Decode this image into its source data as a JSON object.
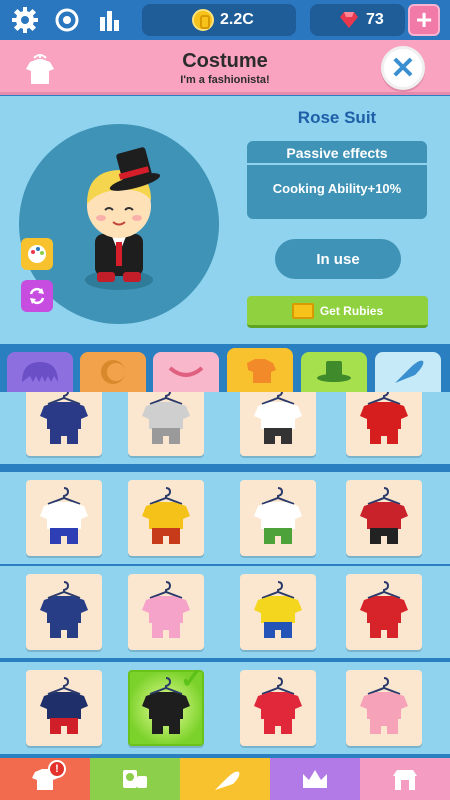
{
  "topbar": {
    "coins": "2.2C",
    "rubies": "73",
    "add_label": "+"
  },
  "header": {
    "title": "Costume",
    "subtitle": "I'm a fashionista!",
    "close_label": "✕"
  },
  "details": {
    "item_name": "Rose Suit",
    "effects_title": "Passive effects",
    "effect_value": "Cooking Ability+10%",
    "in_use_label": "In use",
    "get_rubies_label": "Get Rubies"
  },
  "tabs": [
    {
      "name": "hair",
      "color": "#8d6fe0"
    },
    {
      "name": "face",
      "color": "#f2a24a"
    },
    {
      "name": "mouth",
      "color": "#f9b7cc"
    },
    {
      "name": "clothes",
      "color": "#f8c22e"
    },
    {
      "name": "hat",
      "color": "#a6e04d"
    },
    {
      "name": "accessory",
      "color": "#c6eaf7"
    }
  ],
  "selected_tab": "clothes",
  "costume_rows": [
    [
      {
        "name": "navy-tracksuit",
        "top": "#2b3a86",
        "bottom": "#2b3a86"
      },
      {
        "name": "grey-hoodie",
        "top": "#cfcfcf",
        "bottom": "#9a9a9a"
      },
      {
        "name": "doctor-coat",
        "top": "#ffffff",
        "bottom": "#333333"
      },
      {
        "name": "red-qipao",
        "top": "#d61e1e",
        "bottom": "#d61e1e"
      }
    ],
    [
      {
        "name": "cheerleader",
        "top": "#ffffff",
        "bottom": "#2e3fb5"
      },
      {
        "name": "yellow-jacket",
        "top": "#f5c21a",
        "bottom": "#c73a1a"
      },
      {
        "name": "green-shirt",
        "top": "#ffffff",
        "bottom": "#4ea23a"
      },
      {
        "name": "striped-shirt",
        "top": "#c9222a",
        "bottom": "#222222"
      }
    ],
    [
      {
        "name": "navy-uniform",
        "top": "#273e86",
        "bottom": "#273e86"
      },
      {
        "name": "pink-onesie",
        "top": "#f6a3c9",
        "bottom": "#f6a3c9"
      },
      {
        "name": "soccer-kit",
        "top": "#f4d61e",
        "bottom": "#2554b8"
      },
      {
        "name": "red-folk-dress",
        "top": "#d6242a",
        "bottom": "#d6242a"
      }
    ],
    [
      {
        "name": "sailor-dress",
        "top": "#1f2f6a",
        "bottom": "#d11f2a"
      },
      {
        "name": "rose-suit",
        "top": "#1e1e1e",
        "bottom": "#1e1e1e"
      },
      {
        "name": "red-skirt",
        "top": "#e0283a",
        "bottom": "#e0283a"
      },
      {
        "name": "pink-overalls",
        "top": "#f6a3b9",
        "bottom": "#f6a3b9"
      }
    ]
  ],
  "selected_costume": "rose-suit",
  "bottom_nav": [
    {
      "name": "costume",
      "color": "#f36b4f",
      "badge": "!"
    },
    {
      "name": "staff",
      "color": "#8ccf4a",
      "badge": ""
    },
    {
      "name": "cooking",
      "color": "#f8c22e",
      "badge": ""
    },
    {
      "name": "rank",
      "color": "#b27ae6",
      "badge": ""
    },
    {
      "name": "shop",
      "color": "#f59cc3",
      "badge": ""
    }
  ]
}
